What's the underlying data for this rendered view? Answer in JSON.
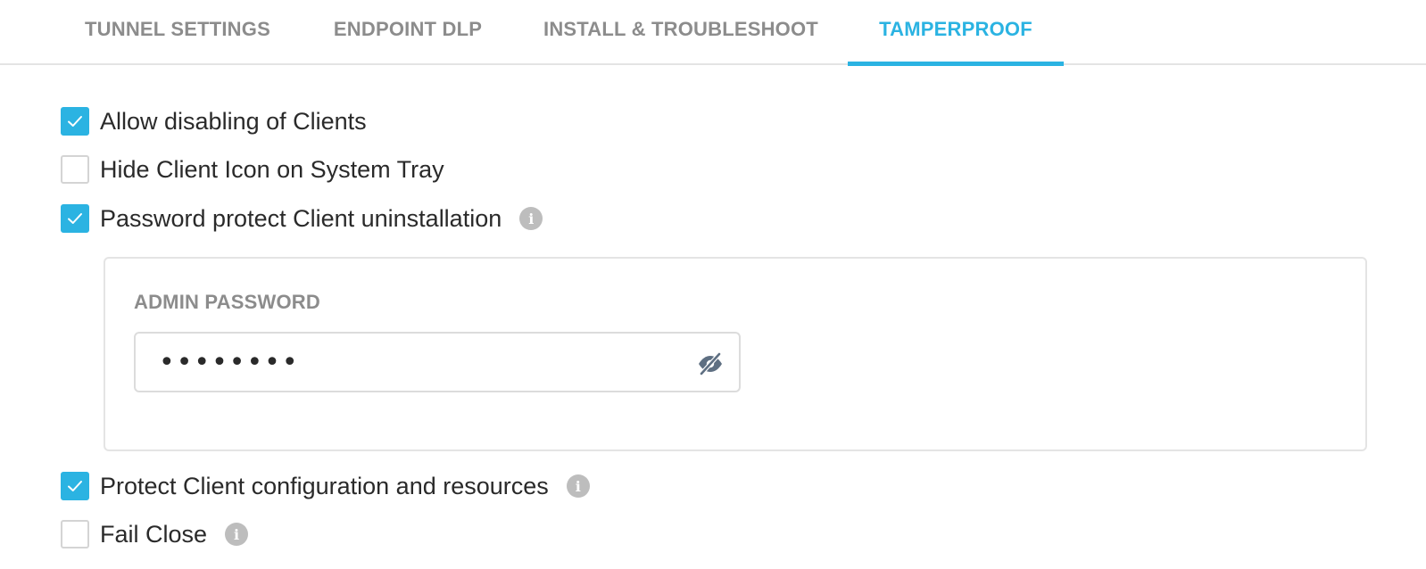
{
  "tabs": [
    {
      "label": "TUNNEL SETTINGS",
      "active": false
    },
    {
      "label": "ENDPOINT DLP",
      "active": false
    },
    {
      "label": "INSTALL & TROUBLESHOOT",
      "active": false
    },
    {
      "label": "TAMPERPROOF",
      "active": true
    }
  ],
  "options": {
    "allow_disabling": {
      "label": "Allow disabling of Clients",
      "checked": true
    },
    "hide_icon": {
      "label": "Hide Client Icon on System Tray",
      "checked": false
    },
    "password_protect": {
      "label": "Password protect Client uninstallation",
      "checked": true
    },
    "protect_config": {
      "label": "Protect Client configuration and resources",
      "checked": true
    },
    "fail_close": {
      "label": "Fail Close",
      "checked": false
    }
  },
  "admin_password": {
    "label": "ADMIN PASSWORD",
    "value": "••••••••"
  },
  "icons": {
    "info": "info-icon",
    "toggle_visibility": "eye-slash-icon",
    "check": "checkmark-icon"
  },
  "colors": {
    "accent": "#2bb3e2",
    "tab_inactive": "#8c8c8c",
    "text": "#2a2a2a",
    "info_icon": "#bdbdbd"
  }
}
